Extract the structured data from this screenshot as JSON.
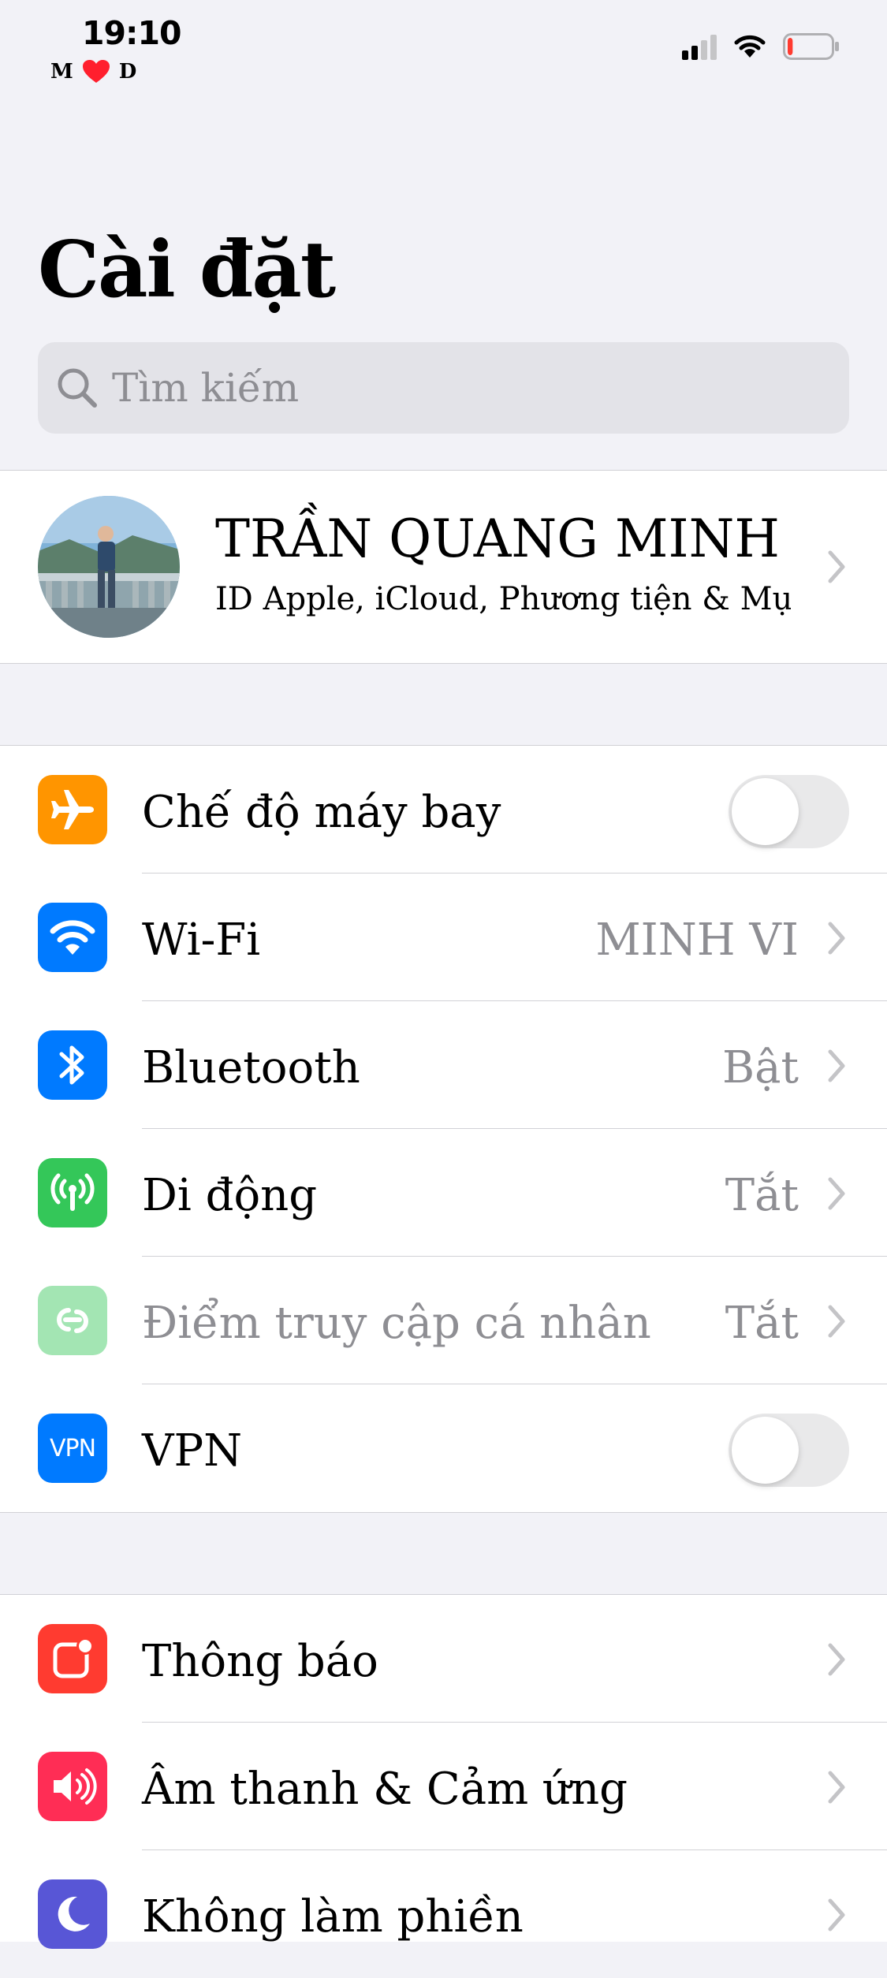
{
  "status_bar": {
    "time": "19:10",
    "carrier_left": "M",
    "carrier_right": "D",
    "battery_level": 0.12,
    "battery_color": "#ff3b30"
  },
  "page": {
    "title": "Cài đặt"
  },
  "search": {
    "placeholder": "Tìm kiếm",
    "icon": "magnifier-icon"
  },
  "profile": {
    "name": "TRẦN QUANG MINH",
    "subtitle": "ID Apple, iCloud, Phương tiện & Mụ..."
  },
  "connectivity": [
    {
      "label": "Chế độ máy bay",
      "type": "toggle",
      "on": false,
      "icon": "airplane-icon",
      "color": "#ff9500"
    },
    {
      "label": "Wi-Fi",
      "value": "MINH VI",
      "icon": "wifi-icon",
      "color": "#007aff"
    },
    {
      "label": "Bluetooth",
      "value": "Bật",
      "icon": "bluetooth-icon",
      "color": "#007aff"
    },
    {
      "label": "Di động",
      "value": "Tắt",
      "icon": "antenna-icon",
      "color": "#34c759"
    },
    {
      "label": "Điểm truy cập cá nhân",
      "value": "Tắt",
      "icon": "hotspot-icon",
      "color": "#34c759",
      "disabled": true
    },
    {
      "label": "VPN",
      "type": "toggle",
      "on": false,
      "icon": "vpn-icon",
      "icon_text": "VPN",
      "color": "#007aff"
    }
  ],
  "general": [
    {
      "label": "Thông báo",
      "icon": "notifications-icon",
      "color": "#ff3b30"
    },
    {
      "label": "Âm thanh & Cảm ứng",
      "icon": "speaker-icon",
      "color": "#ff2d55"
    },
    {
      "label": "Không làm phiền",
      "icon": "moon-icon",
      "color": "#5856d6"
    }
  ]
}
